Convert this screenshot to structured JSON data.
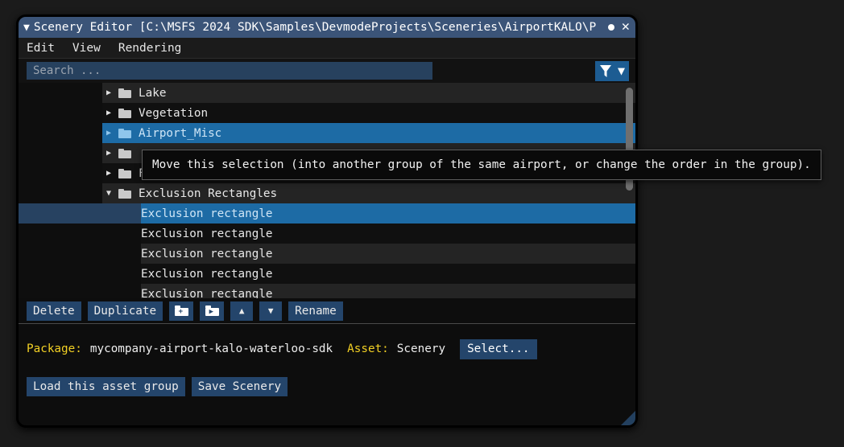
{
  "window": {
    "title": "Scenery Editor [C:\\MSFS 2024 SDK\\Samples\\DevmodeProjects\\Sceneries\\AirportKALO\\P",
    "collapse_glyph": "▼",
    "close_glyph": "✕"
  },
  "menubar": {
    "items": [
      {
        "label": "Edit"
      },
      {
        "label": "View"
      },
      {
        "label": "Rendering"
      }
    ]
  },
  "search": {
    "placeholder": "Search ...",
    "value": "",
    "filter_icon": "funnel-icon",
    "caret_glyph": "▼"
  },
  "tree": {
    "rows": [
      {
        "label": "Lake",
        "arrow": "▶",
        "depth": 1,
        "selected": false,
        "stripe": "light"
      },
      {
        "label": "Vegetation",
        "arrow": "▶",
        "depth": 1,
        "selected": false,
        "stripe": "dark"
      },
      {
        "label": "Airport_Misc",
        "arrow": "▶",
        "depth": 1,
        "selected": true,
        "stripe": "sel"
      },
      {
        "label": "",
        "arrow": "▶",
        "depth": 1,
        "selected": false,
        "stripe": "light"
      },
      {
        "label": "Fuel Storage",
        "arrow": "▶",
        "depth": 1,
        "selected": false,
        "stripe": "dark"
      },
      {
        "label": "Exclusion Rectangles",
        "arrow": "▼",
        "depth": 1,
        "selected": false,
        "stripe": "light"
      },
      {
        "label": "Exclusion rectangle",
        "arrow": "",
        "depth": 2,
        "selected": true,
        "stripe": "sel"
      },
      {
        "label": "Exclusion rectangle",
        "arrow": "",
        "depth": 2,
        "selected": false,
        "stripe": "dark"
      },
      {
        "label": "Exclusion rectangle",
        "arrow": "",
        "depth": 2,
        "selected": false,
        "stripe": "light"
      },
      {
        "label": "Exclusion rectangle",
        "arrow": "",
        "depth": 2,
        "selected": false,
        "stripe": "dark"
      },
      {
        "label": "Exclusion rectangle",
        "arrow": "",
        "depth": 2,
        "selected": false,
        "stripe": "light"
      }
    ]
  },
  "tooltip": {
    "text": "Move this selection (into another group of the same airport, or change the order in the group)."
  },
  "toolbar": {
    "delete_label": "Delete",
    "duplicate_label": "Duplicate",
    "new_group_glyph": "+",
    "move_group_glyph": "▶",
    "move_up_glyph": "▲",
    "move_down_glyph": "▼",
    "rename_label": "Rename"
  },
  "info": {
    "package_label": "Package:",
    "package_value": "mycompany-airport-kalo-waterloo-sdk",
    "asset_label": "Asset:",
    "asset_value": "Scenery",
    "select_label": "Select..."
  },
  "actions": {
    "load_label": "Load this asset group",
    "save_label": "Save Scenery"
  },
  "colors": {
    "titlebar": "#3b5478",
    "accent_blue": "#24456b",
    "selection_blue": "#1d6ba5",
    "label_yellow": "#f2d024",
    "filter_blue": "#1d5c92"
  }
}
